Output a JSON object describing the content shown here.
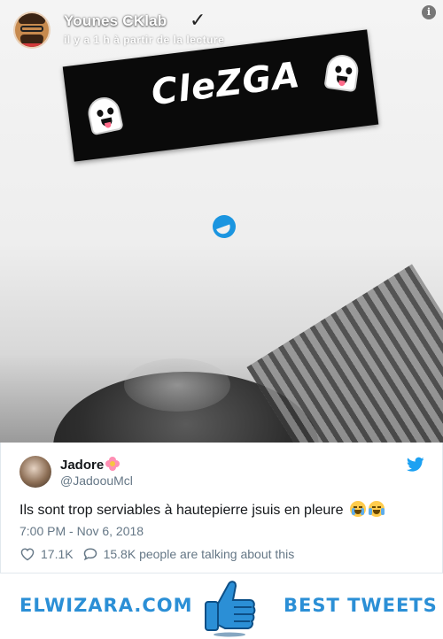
{
  "snap": {
    "username": "Younes CKlab",
    "time_text": "il y a 1 h à partir de la lecture",
    "banner_text": "CleZGA",
    "info_symbol": "i"
  },
  "tweet": {
    "display_name": "Jadore",
    "handle": "@JadoouMcl",
    "text": "Ils sont trop serviables à hautepierre jsuis en pleure",
    "timestamp": "7:00 PM - Nov 6, 2018",
    "likes": "17.1K",
    "talking": "15.8K people are talking about this",
    "accent_color": "#1da1f2"
  },
  "footer": {
    "left_text": "ELWIZARA.COM",
    "right_text": "BEST TWEETS",
    "brand_color": "#2b8fd6"
  }
}
